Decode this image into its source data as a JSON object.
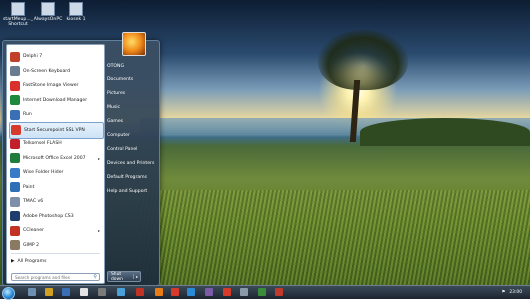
{
  "desktop": {
    "icons": [
      {
        "label": "startMeup..._ Shortcut"
      },
      {
        "label": "AlwaysOnPC"
      },
      {
        "label": "kiosek 1"
      }
    ]
  },
  "start_menu": {
    "programs": [
      {
        "label": "Delphi 7",
        "icon": "delphi-icon",
        "color": "#c2402a"
      },
      {
        "label": "On-Screen Keyboard",
        "icon": "keyboard-icon",
        "color": "#6a7c92"
      },
      {
        "label": "FastStone Image Viewer",
        "icon": "image-viewer-icon",
        "color": "#d9302b"
      },
      {
        "label": "Internet Download Manager",
        "icon": "download-icon",
        "color": "#1f8a3c"
      },
      {
        "label": "Run",
        "icon": "run-icon",
        "color": "#3a6fb5"
      },
      {
        "label": "Start Securepoint SSL VPN",
        "icon": "vpn-icon",
        "color": "#d63a2a"
      },
      {
        "label": "Telkomsel FLASH",
        "icon": "flash-icon",
        "color": "#c21f2a"
      },
      {
        "label": "Microsoft Office Excel 2007",
        "icon": "excel-icon",
        "color": "#1e7d3a"
      },
      {
        "label": "Wise Folder Hider",
        "icon": "folder-hider-icon",
        "color": "#3a7bc8"
      },
      {
        "label": "Paint",
        "icon": "paint-icon",
        "color": "#2f6fb6"
      },
      {
        "label": "TMAC v6",
        "icon": "tmac-icon",
        "color": "#7d8fa8"
      },
      {
        "label": "Adobe Photoshop CS3",
        "icon": "photoshop-icon",
        "color": "#1c3d6e"
      },
      {
        "label": "CCleaner",
        "icon": "ccleaner-icon",
        "color": "#c23324"
      },
      {
        "label": "GIMP 2",
        "icon": "gimp-icon",
        "color": "#8a7a62"
      }
    ],
    "all_programs": "All Programs",
    "search_placeholder": "Search programs and files",
    "user_name": "OTONG",
    "places": [
      "Documents",
      "Pictures",
      "Music",
      "Games",
      "Computer",
      "Control Panel",
      "Devices and Printers",
      "Default Programs",
      "Help and Support"
    ],
    "shutdown_label": "Shut down"
  },
  "taskbar": {
    "clock": "23:00",
    "colors": [
      "#6d8fb0",
      "#d0a020",
      "#3a6fb5",
      "#e2e2e2",
      "#7a7a7a",
      "#4aa0d8",
      "#c23324",
      "#e87d14",
      "#d63a2a",
      "#2b8ad6",
      "#7c5aa8",
      "#d63a2a",
      "#8a9aa8",
      "#3a8c3a",
      "#c0392b"
    ]
  }
}
